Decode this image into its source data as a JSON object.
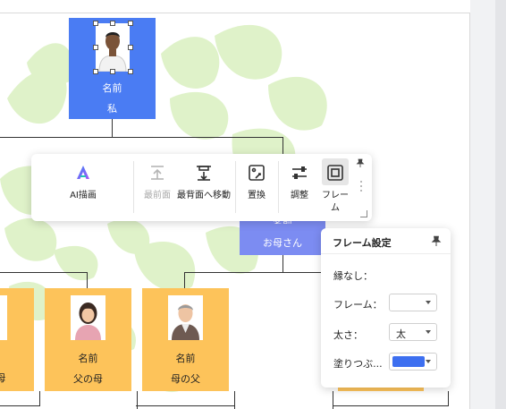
{
  "colors": {
    "blue_node": "#4a7cf3",
    "blue_light": "#7c8cf2",
    "yellow_node": "#fdc35a",
    "leaf": "#dff2c9",
    "accent": "#3d6ff0"
  },
  "nodes": {
    "me": {
      "name": "名前",
      "relation": "私"
    },
    "mother": {
      "name": "名前",
      "relation": "お母さん"
    },
    "father_mother_left": {
      "relation": "母"
    },
    "fathers_mother": {
      "name": "名前",
      "relation": "父の母"
    },
    "mothers_father": {
      "name": "名前",
      "relation": "母の父"
    }
  },
  "toolbar": {
    "ai": "AI描画",
    "front": "最前面",
    "back": "最背面へ移動",
    "replace": "置換",
    "adjust": "調整",
    "frame": "フレーム"
  },
  "frame_panel": {
    "title": "フレーム設定",
    "no_border": "縁なし：",
    "frame_label": "フレーム：",
    "frame_value": "",
    "thickness_label": "太さ：",
    "thickness_value": "太",
    "fill_label": "塗りつぶ...",
    "fill_color": "#3d6ff0"
  }
}
